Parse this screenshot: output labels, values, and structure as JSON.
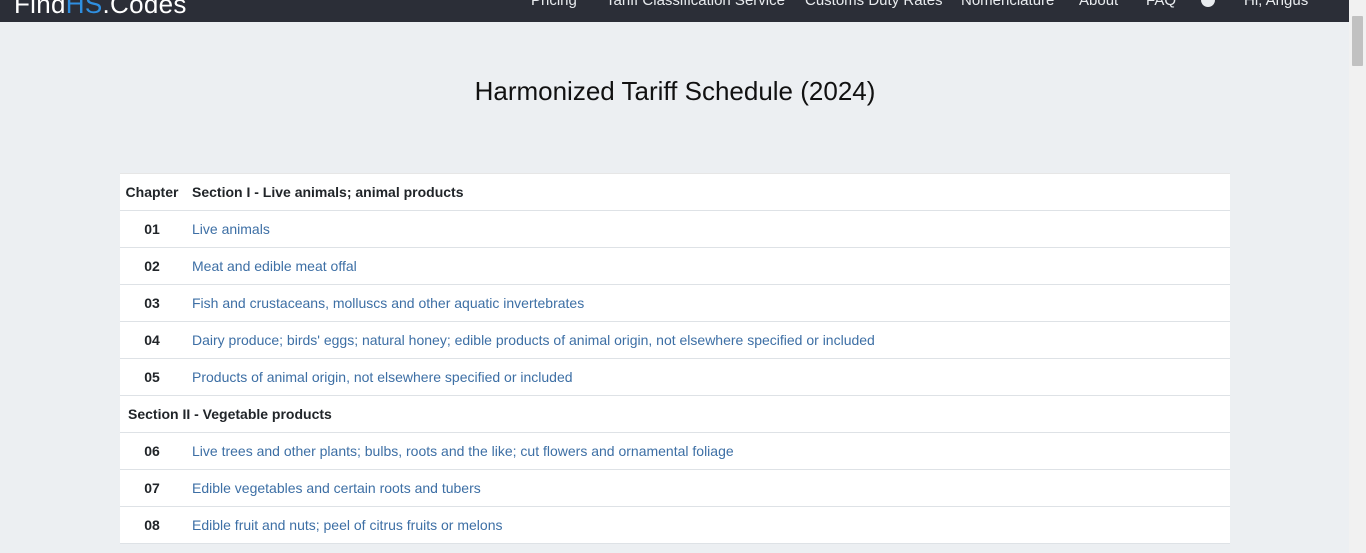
{
  "navbar": {
    "brand_prefix": "Find",
    "brand_accent": "HS",
    "brand_suffix": ".Codes",
    "items": [
      {
        "label": "Pricing"
      },
      {
        "label": "Tariff Classification Service"
      },
      {
        "label": "Customs Duty Rates"
      },
      {
        "label": "Nomenclature"
      },
      {
        "label": "About"
      },
      {
        "label": "FAQ"
      }
    ],
    "cart_icon": "cart-icon",
    "greeting": "Hi, Angus"
  },
  "page": {
    "title": "Harmonized Tariff Schedule (2024)"
  },
  "table": {
    "header_code": "Chapter",
    "section1_title": "Section I - Live animals; animal products",
    "chapters1": [
      {
        "code": "01",
        "label": "Live animals"
      },
      {
        "code": "02",
        "label": "Meat and edible meat offal"
      },
      {
        "code": "03",
        "label": "Fish and crustaceans, molluscs and other aquatic invertebrates"
      },
      {
        "code": "04",
        "label": "Dairy produce; birds' eggs; natural honey; edible products of animal origin, not elsewhere specified or included"
      },
      {
        "code": "05",
        "label": "Products of animal origin, not elsewhere specified or included"
      }
    ],
    "section2_title": "Section II - Vegetable products",
    "chapters2": [
      {
        "code": "06",
        "label": "Live trees and other plants; bulbs, roots and the like; cut flowers and ornamental foliage"
      },
      {
        "code": "07",
        "label": "Edible vegetables and certain roots and tubers"
      },
      {
        "code": "08",
        "label": "Edible fruit and nuts; peel of citrus fruits or melons"
      }
    ]
  },
  "colors": {
    "navbar_bg": "#2b2e37",
    "brand_accent": "#2f8fe0",
    "link": "#3d6fa5",
    "page_bg": "#eceff2"
  }
}
